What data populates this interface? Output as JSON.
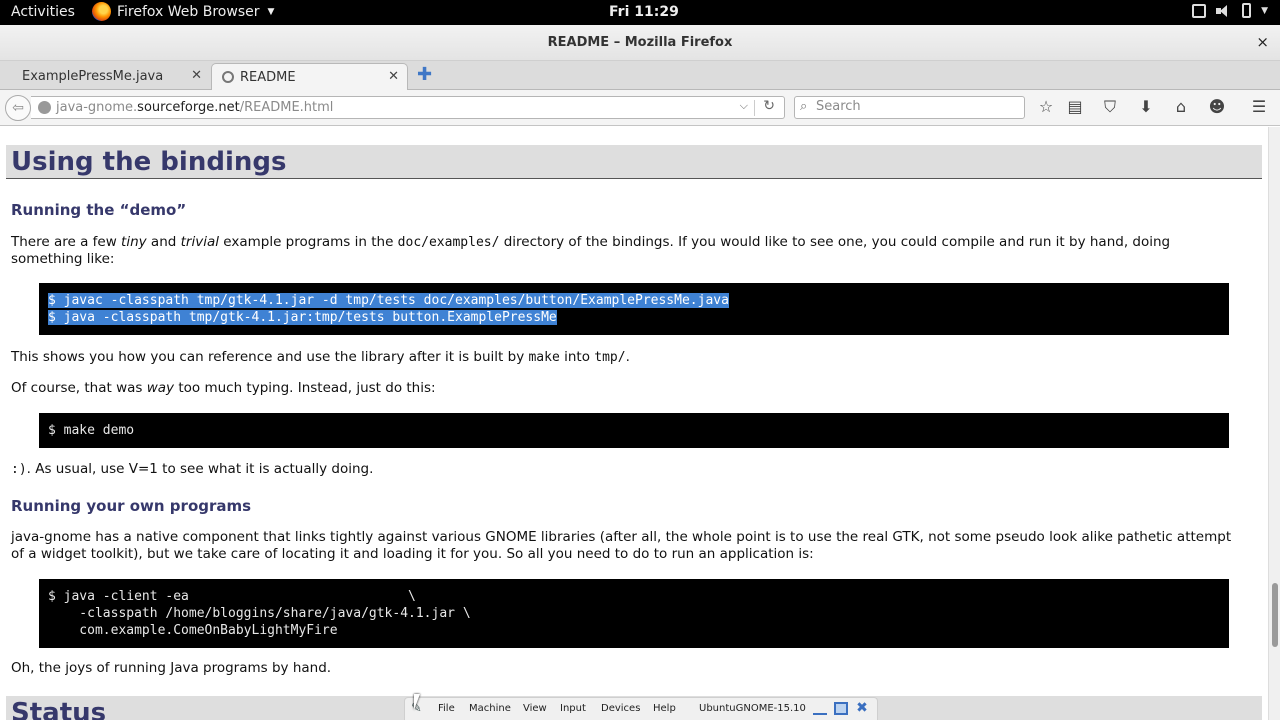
{
  "topbar": {
    "activities": "Activities",
    "app_name": "Firefox Web Browser",
    "clock": "Fri 11:29"
  },
  "window": {
    "title": "README – Mozilla Firefox",
    "close_glyph": "×"
  },
  "tabs": [
    {
      "label": "ExamplePressMe.java",
      "active": false
    },
    {
      "label": "README",
      "active": true
    }
  ],
  "nav": {
    "url_prefix": "java-gnome.",
    "url_host": "sourceforge.net",
    "url_path": "/README.html",
    "search_placeholder": "Search"
  },
  "content": {
    "section_title": "Using the bindings",
    "demo": {
      "heading": "Running the “demo”",
      "p1_a": "There are a few ",
      "p1_tiny": "tiny",
      "p1_b": " and ",
      "p1_trivial": "trivial",
      "p1_c": " example programs in the ",
      "p1_dir": "doc/examples/",
      "p1_d": " directory of the bindings. If you would like to see one, you could compile and run it by hand, doing something like:",
      "code_line1": "$ javac -classpath tmp/gtk-4.1.jar -d tmp/tests doc/examples/button/ExamplePressMe.java",
      "code_line2": "$ java -classpath tmp/gtk-4.1.jar:tmp/tests button.ExamplePressMe",
      "p2_a": "This shows you how you can reference and use the library after it is built by ",
      "p2_make": "make",
      "p2_b": " into ",
      "p2_tmp": "tmp/",
      "p2_c": ".",
      "p3_a": "Of course, that was ",
      "p3_way": "way",
      "p3_b": " too much typing. Instead, just do this:",
      "code_make": "$ make demo",
      "p4_smiley": ":)",
      "p4_text": ". As usual, use V=1 to see what it is actually doing."
    },
    "own": {
      "heading": "Running your own programs",
      "p1": "java-gnome has a native component that links tightly against various GNOME libraries (after all, the whole point is to use the real GTK, not some pseudo look alike pathetic attempt of a widget toolkit), but we take care of locating it and loading it for you. So all you need to do to run an application is:",
      "code": "$ java -client -ea                            \\\n    -classpath /home/bloggins/share/java/gtk-4.1.jar \\\n    com.example.ComeOnBabyLightMyFire",
      "p2": "Oh, the joys of running Java programs by hand."
    },
    "next_section_title": "Status"
  },
  "vbox": {
    "menus": [
      "File",
      "Machine",
      "View",
      "Input",
      "Devices",
      "Help"
    ],
    "vm_name": "UbuntuGNOME-15.10"
  },
  "colors": {
    "heading": "#36386b",
    "selection": "#3f82d4",
    "code_bg": "#000000"
  }
}
